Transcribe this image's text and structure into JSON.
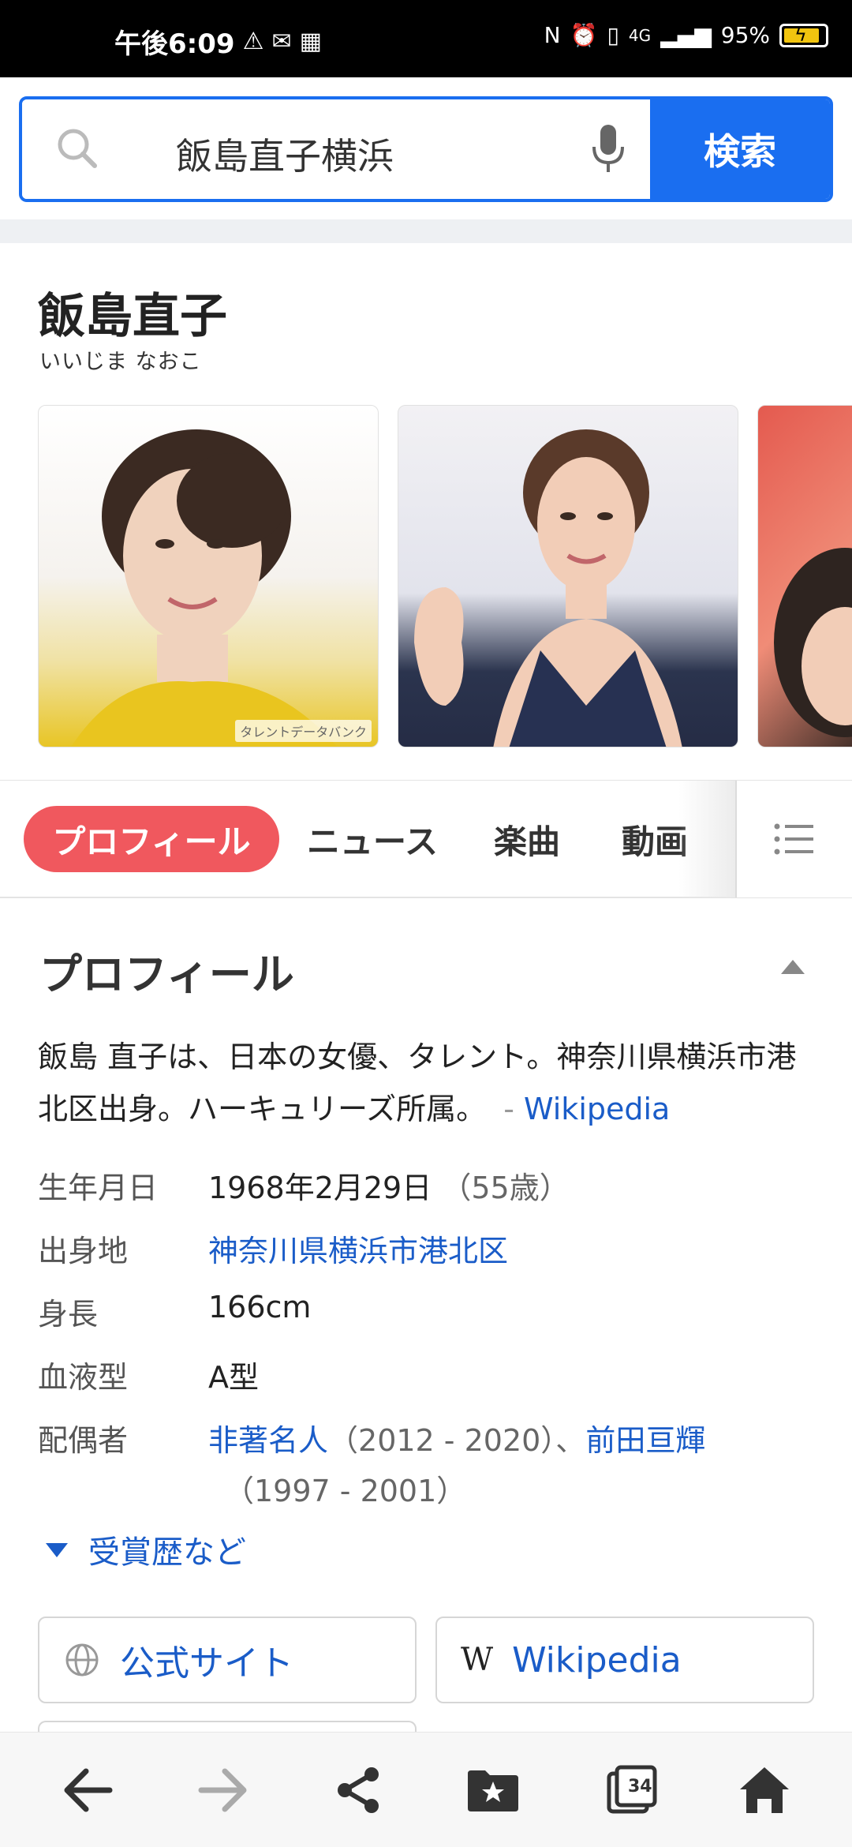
{
  "status_bar": {
    "time": "午後6:09",
    "network": "4G",
    "battery": "95%"
  },
  "search": {
    "query": "飯島直子横浜",
    "button_label": "検索"
  },
  "entity": {
    "name": "飯島直子",
    "reading": "いいじま なおこ",
    "image_watermark": "タレントデータバンク"
  },
  "tabs": [
    {
      "label": "プロフィール",
      "active": true
    },
    {
      "label": "ニュース"
    },
    {
      "label": "楽曲"
    },
    {
      "label": "動画"
    }
  ],
  "profile": {
    "title": "プロフィール",
    "summary": "飯島 直子は、日本の女優、タレント。神奈川県横浜市港北区出身。ハーキュリーズ所属。",
    "summary_dash": "-",
    "summary_source": "Wikipedia",
    "facts": {
      "birth_label": "生年月日",
      "birth_value": "1968年2月29日",
      "birth_age": "（55歳）",
      "origin_label": "出身地",
      "origin_value": "神奈川県横浜市港北区",
      "height_label": "身長",
      "height_value": "166cm",
      "blood_label": "血液型",
      "blood_value": "A型",
      "spouse_label": "配偶者",
      "spouse1_name": "非著名人",
      "spouse1_years": "（2012 - 2020）、",
      "spouse2_name": "前田亘輝",
      "spouse2_years": "（1997 - 2001）"
    },
    "awards_label": "受賞歴など"
  },
  "links": {
    "official": "公式サイト",
    "wikipedia": "Wikipedia",
    "wiki_glyph": "W"
  },
  "bottom_nav": {
    "tab_count": "34"
  },
  "colors": {
    "accent_blue": "#1a6ef0",
    "link_blue": "#1a5cc8",
    "active_tab": "#f0585e"
  }
}
